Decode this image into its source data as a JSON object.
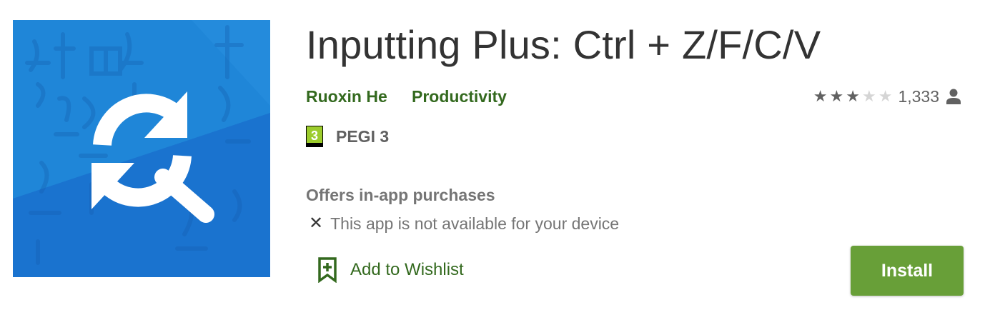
{
  "app": {
    "title": "Inputting Plus: Ctrl + Z/F/C/V",
    "developer": "Ruoxin He",
    "category": "Productivity",
    "rating_stars": 3,
    "rating_max": 5,
    "rating_count": "1,333",
    "content_rating": {
      "badge": "3",
      "label": "PEGI 3"
    },
    "in_app_purchases": "Offers in-app purchases",
    "availability": {
      "icon": "close-icon",
      "text": "This app is not available for your device"
    },
    "wishlist_label": "Add to Wishlist",
    "install_label": "Install",
    "icon_name": "sync-search-icon"
  },
  "colors": {
    "brand_green": "#33691e",
    "install_green": "#689f38",
    "icon_blue": "#1976d2",
    "text_gray": "#757575",
    "star_on": "#616161",
    "star_off": "#d5d5d5"
  }
}
